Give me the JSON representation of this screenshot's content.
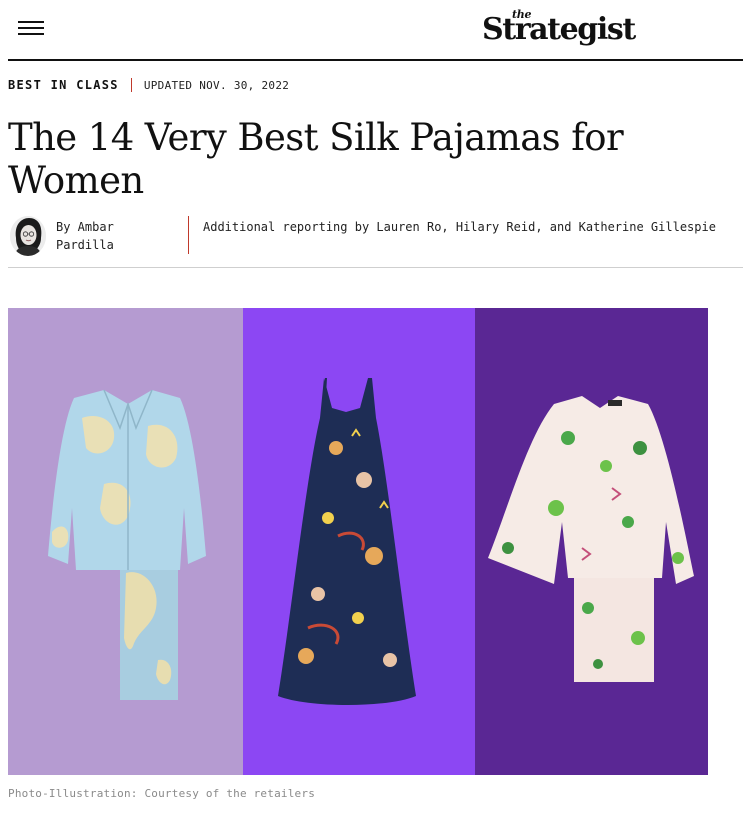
{
  "header": {
    "menu_icon": "hamburger-menu-icon",
    "logo_small": "the",
    "logo_main": "Strategist"
  },
  "article": {
    "rubric": "BEST IN CLASS",
    "updated": "UPDATED NOV. 30, 2022",
    "headline": "The 14 Very Best Silk Pajamas for Women",
    "byline": "By Ambar Pardilla",
    "additional_reporting": "Additional reporting by Lauren Ro, Hilary Reid, and Katherine Gillespie",
    "hero_caption": "Photo-Illustration: Courtesy of the retailers"
  },
  "colors": {
    "panel_left": "#b59bd1",
    "panel_middle": "#8c47f3",
    "panel_right": "#5a2794",
    "divider_accent": "#c0392b"
  }
}
